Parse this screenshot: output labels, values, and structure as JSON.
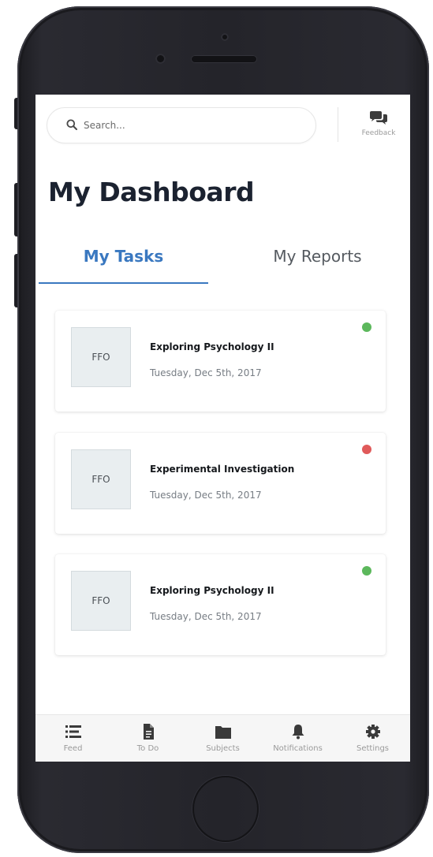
{
  "colors": {
    "accent": "#3a78c0",
    "status_green": "#5cb85c",
    "status_red": "#e05a5a",
    "phone_body": "#24242a"
  },
  "search": {
    "placeholder": "Search...",
    "icon": "search-icon"
  },
  "feedback": {
    "label": "Feedback",
    "icon": "chat-bubbles-icon"
  },
  "page": {
    "title": "My Dashboard"
  },
  "tabs": [
    {
      "label": "My Tasks",
      "active": true
    },
    {
      "label": "My Reports",
      "active": false
    }
  ],
  "tasks": [
    {
      "thumb": "FFO",
      "title": "Exploring Psychology II",
      "date": "Tuesday, Dec 5th, 2017",
      "status": "green"
    },
    {
      "thumb": "FFO",
      "title": "Experimental Investigation",
      "date": "Tuesday, Dec 5th, 2017",
      "status": "red"
    },
    {
      "thumb": "FFO",
      "title": "Exploring Psychology II",
      "date": "Tuesday, Dec 5th, 2017",
      "status": "green"
    }
  ],
  "nav": [
    {
      "label": "Feed",
      "icon": "feed-list-icon"
    },
    {
      "label": "To Do",
      "icon": "document-icon"
    },
    {
      "label": "Subjects",
      "icon": "folder-icon"
    },
    {
      "label": "Notifications",
      "icon": "bell-icon"
    },
    {
      "label": "Settings",
      "icon": "gear-icon"
    }
  ]
}
